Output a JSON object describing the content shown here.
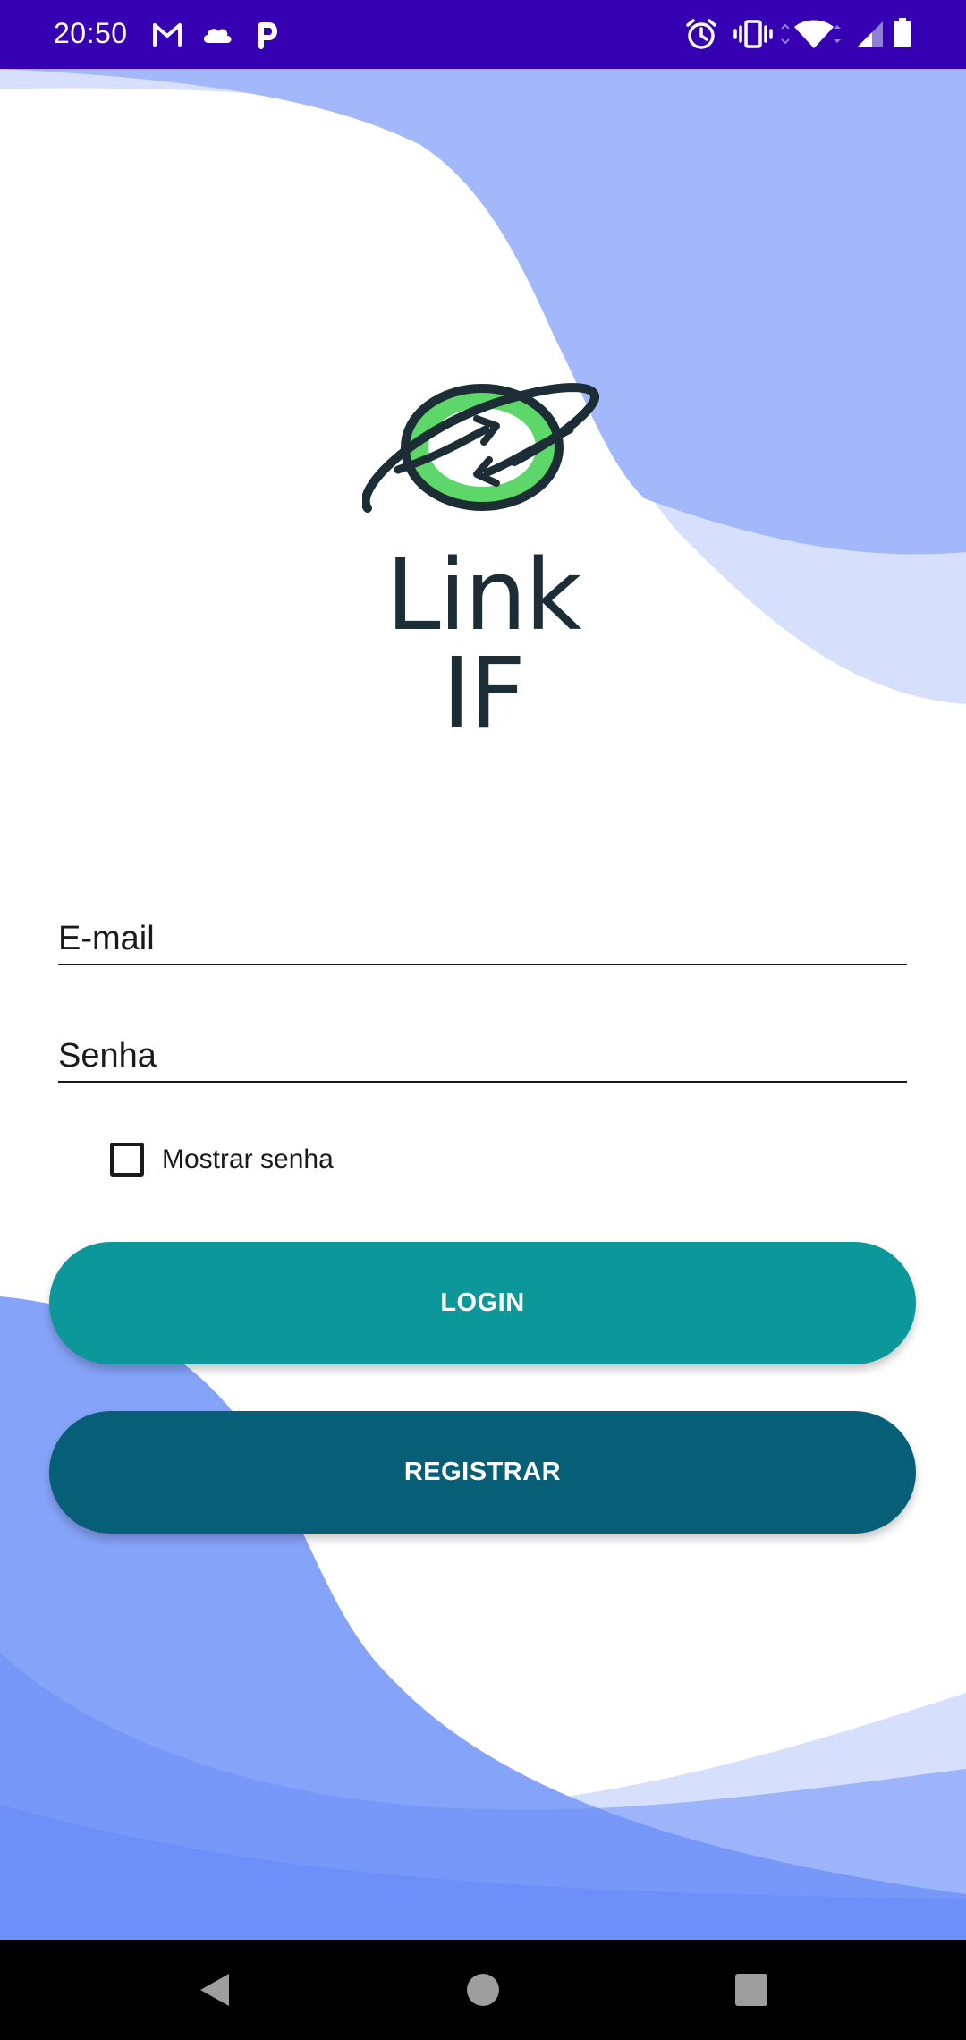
{
  "status_bar": {
    "time": "20:50",
    "left_icons": [
      "gmail-icon",
      "cloud-icon",
      "p-icon"
    ],
    "right_icons": [
      "alarm-icon",
      "vibrate-icon",
      "wifi-icon",
      "signal-icon",
      "battery-icon"
    ]
  },
  "logo": {
    "line1": "Link",
    "line2": "IF",
    "icon": "planet-arrows-icon",
    "accent_color": "#5dd66a"
  },
  "form": {
    "email_placeholder": "E-mail",
    "password_placeholder": "Senha",
    "show_password_label": "Mostrar senha",
    "show_password_checked": false
  },
  "buttons": {
    "login_label": "LOGIN",
    "register_label": "REGISTRAR"
  },
  "colors": {
    "status_bar": "#3600b3",
    "login_button": "#0c979b",
    "register_button": "#075e77",
    "wave_light": "#d6e0fc",
    "wave_medium": "#a3b8fb",
    "wave_dark": "#6c8ff8"
  },
  "nav_bar": {
    "icons": [
      "back-icon",
      "home-icon",
      "recents-icon"
    ]
  }
}
